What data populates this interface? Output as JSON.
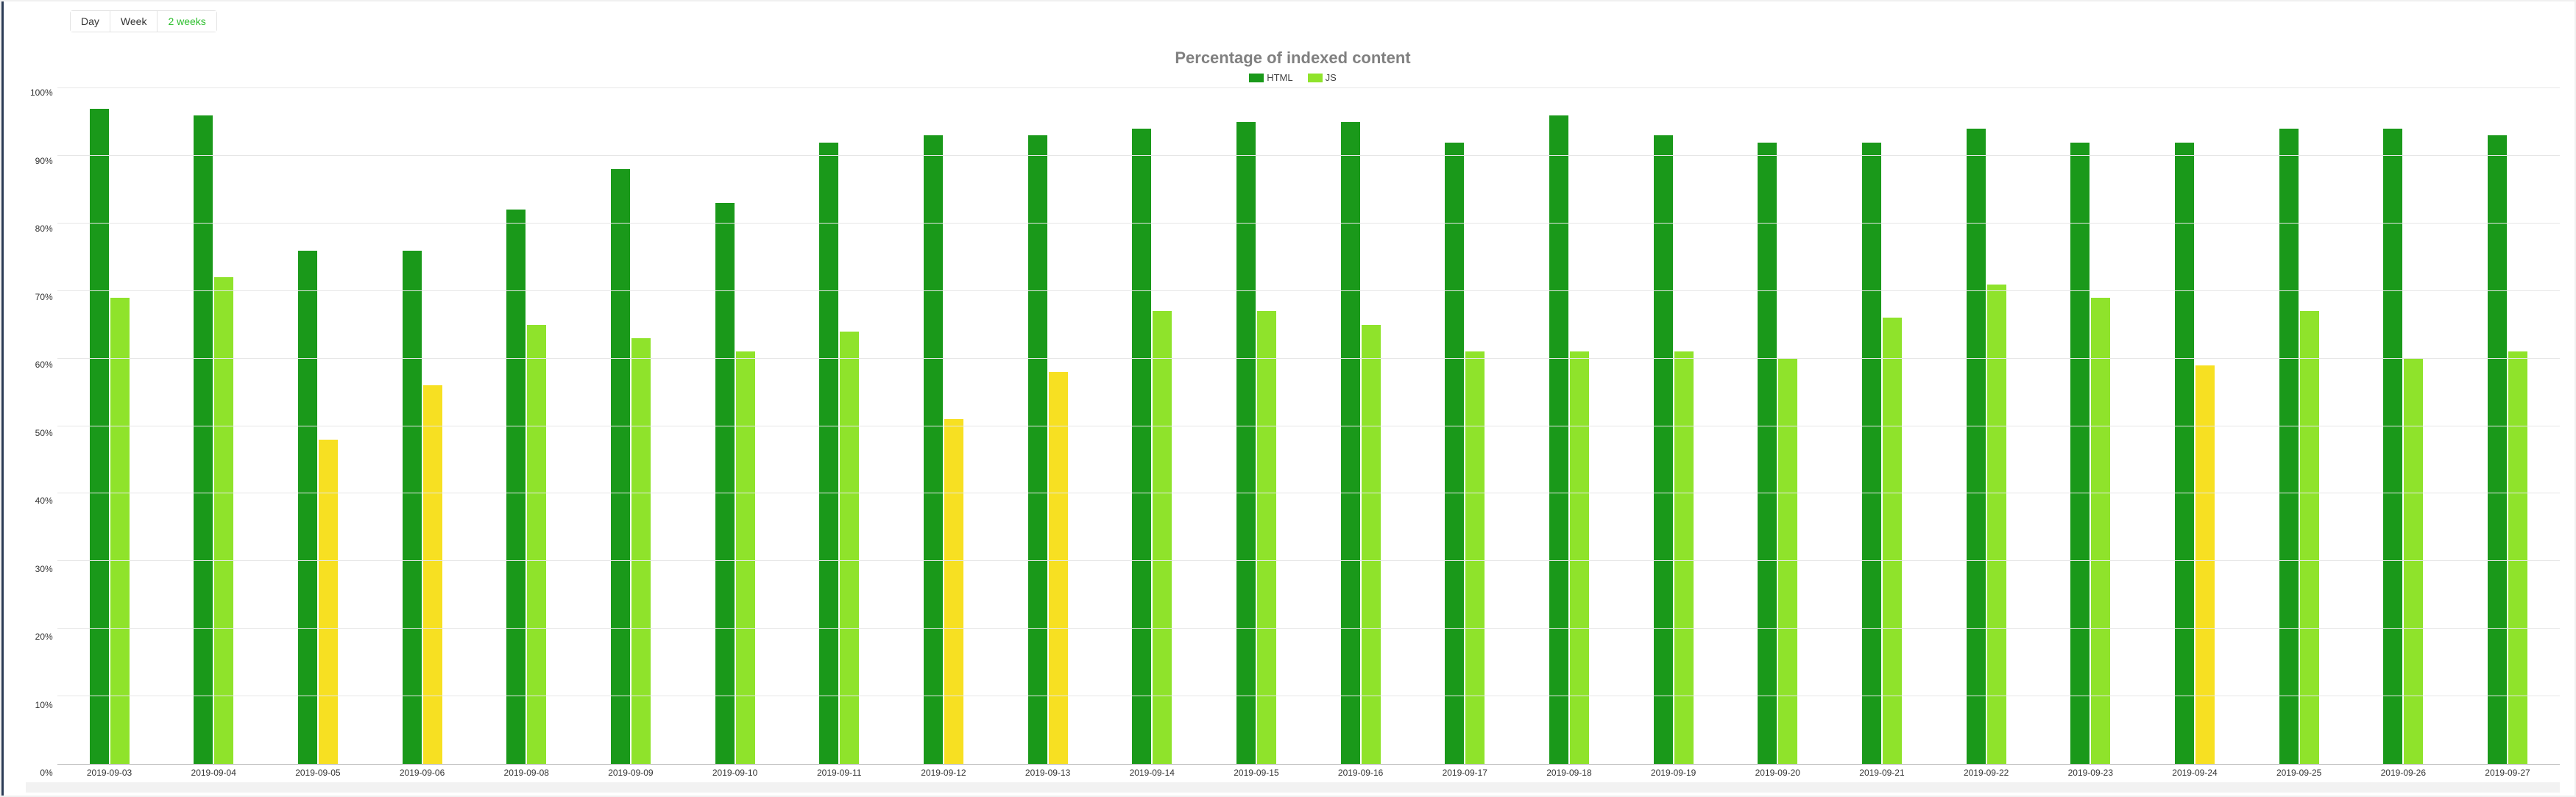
{
  "range_selector": {
    "options": [
      "Day",
      "Week",
      "2 weeks"
    ],
    "active_index": 2
  },
  "chart_data": {
    "type": "bar",
    "title": "Percentage of indexed content",
    "ylabel": "",
    "xlabel": "",
    "ylim": [
      0,
      100
    ],
    "y_ticks": [
      "100%",
      "90%",
      "80%",
      "70%",
      "60%",
      "50%",
      "40%",
      "30%",
      "20%",
      "10%",
      "0%"
    ],
    "categories": [
      "2019-09-03",
      "2019-09-04",
      "2019-09-05",
      "2019-09-06",
      "2019-09-08",
      "2019-09-09",
      "2019-09-10",
      "2019-09-11",
      "2019-09-12",
      "2019-09-13",
      "2019-09-14",
      "2019-09-15",
      "2019-09-16",
      "2019-09-17",
      "2019-09-18",
      "2019-09-19",
      "2019-09-20",
      "2019-09-21",
      "2019-09-22",
      "2019-09-23",
      "2019-09-24",
      "2019-09-25",
      "2019-09-26",
      "2019-09-27"
    ],
    "series": [
      {
        "name": "HTML",
        "color": "#1a991a",
        "values": [
          97,
          96,
          76,
          76,
          82,
          88,
          83,
          92,
          93,
          93,
          94,
          95,
          95,
          92,
          96,
          93,
          92,
          92,
          94,
          92,
          92,
          94,
          94,
          93
        ]
      },
      {
        "name": "JS",
        "color": "#8fe32b",
        "alt_color": "#f7e022",
        "values": [
          69,
          72,
          48,
          56,
          65,
          63,
          61,
          64,
          51,
          58,
          67,
          67,
          65,
          61,
          61,
          61,
          60,
          66,
          71,
          69,
          59,
          67,
          60,
          61
        ],
        "alt_color_flags": [
          false,
          false,
          true,
          true,
          false,
          false,
          false,
          false,
          true,
          true,
          false,
          false,
          false,
          false,
          false,
          false,
          false,
          false,
          false,
          false,
          true,
          false,
          false,
          false
        ]
      }
    ],
    "legend": [
      "HTML",
      "JS"
    ]
  }
}
